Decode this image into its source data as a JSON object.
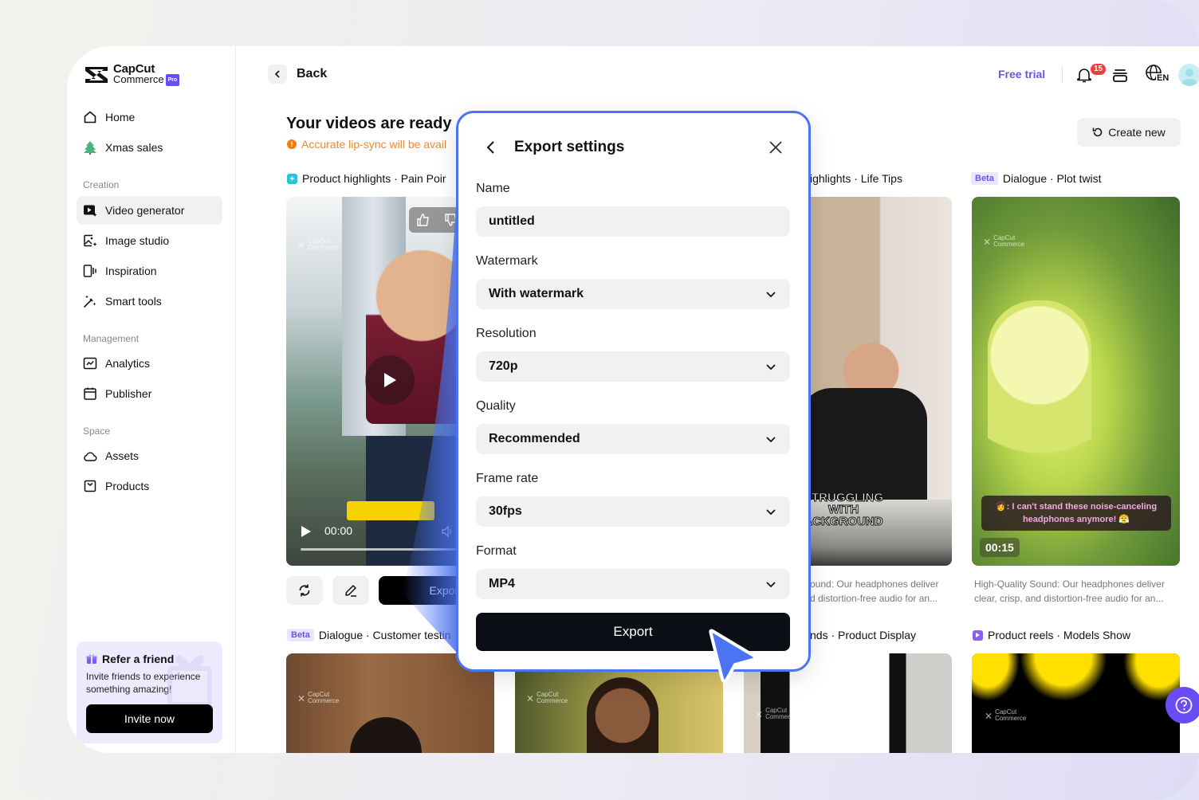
{
  "app": {
    "brand_line1": "CapCut",
    "brand_line2": "Commerce",
    "brand_badge": "Pro",
    "accent_color": "#6b55e6",
    "modal_border_color": "#4a74f4"
  },
  "sidebar": {
    "top_items": [
      {
        "label": "Home",
        "icon": "home-icon"
      },
      {
        "label": "Xmas sales",
        "icon": "xmas-tree-icon"
      }
    ],
    "sections": [
      {
        "title": "Creation",
        "items": [
          {
            "label": "Video generator",
            "icon": "video-generator-icon",
            "active": true
          },
          {
            "label": "Image studio",
            "icon": "image-studio-icon"
          },
          {
            "label": "Inspiration",
            "icon": "inspiration-icon"
          },
          {
            "label": "Smart tools",
            "icon": "magic-wand-icon"
          }
        ]
      },
      {
        "title": "Management",
        "items": [
          {
            "label": "Analytics",
            "icon": "analytics-icon"
          },
          {
            "label": "Publisher",
            "icon": "calendar-icon"
          }
        ]
      },
      {
        "title": "Space",
        "items": [
          {
            "label": "Assets",
            "icon": "cloud-icon"
          },
          {
            "label": "Products",
            "icon": "product-box-icon"
          }
        ]
      }
    ],
    "refer": {
      "title": "Refer a friend",
      "description": "Invite friends to experience something amazing!",
      "button": "Invite now"
    }
  },
  "header": {
    "back_label": "Back",
    "free_trial": "Free trial",
    "notification_count": "15",
    "language": "EN"
  },
  "main": {
    "title": "Your videos are ready",
    "notice": "Accurate lip-sync will be avail",
    "create_new": "Create new",
    "cards": [
      {
        "label": "Product highlights · Pain Poir",
        "beta": false,
        "timestamp": "00:00",
        "export_label": "Export"
      },
      {
        "label": "ighlights · Life Tips",
        "beta": false,
        "description": "ound: Our headphones deliver\nd distortion-free audio for an...",
        "overlay_text": "STRUGGLING\nWITH\nACKGROUND"
      },
      {
        "label": "Dialogue · Plot twist",
        "beta": true,
        "beta_label": "Beta",
        "timestamp": "00:15",
        "caption": "👩: I can't stand these noise-canceling headphones anymore! 😤",
        "description": "High-Quality Sound: Our headphones deliver clear, crisp, and distortion-free audio for an..."
      },
      {
        "label": "Dialogue · Customer testin",
        "beta": true,
        "beta_label": "Beta"
      },
      {
        "label": "nds · Product Display",
        "beta": false
      },
      {
        "label": "Product reels · Models Show",
        "beta": false
      }
    ],
    "watermark_line1": "CapCut",
    "watermark_line2": "Commerce"
  },
  "modal": {
    "title": "Export settings",
    "fields": [
      {
        "label": "Name",
        "value": "untitled",
        "type": "input"
      },
      {
        "label": "Watermark",
        "value": "With watermark",
        "type": "select"
      },
      {
        "label": "Resolution",
        "value": "720p",
        "type": "select"
      },
      {
        "label": "Quality",
        "value": "Recommended",
        "type": "select"
      },
      {
        "label": "Frame rate",
        "value": "30fps",
        "type": "select"
      },
      {
        "label": "Format",
        "value": "MP4",
        "type": "select"
      }
    ],
    "export_button": "Export"
  }
}
